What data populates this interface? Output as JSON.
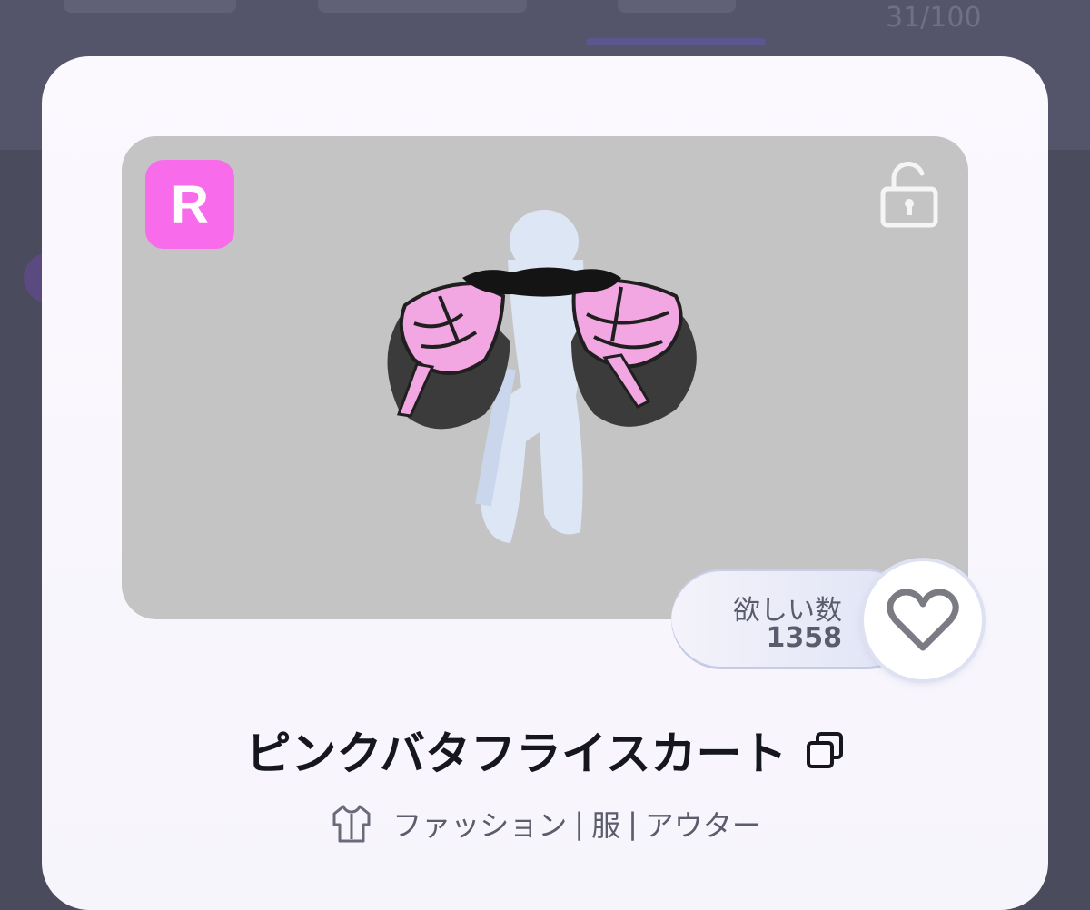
{
  "background": {
    "collection_count": "31/100"
  },
  "item": {
    "rarity": "R",
    "wish_label": "欲しい数",
    "wish_count": "1358",
    "name": "ピンクバタフライスカート",
    "categories": [
      "ファッション",
      "服",
      "アウター"
    ]
  },
  "colors": {
    "rarity_badge": "#f86bea",
    "preview_bg": "#c4c4c4",
    "wing_pink": "#f3a3e4",
    "wing_dark": "#2a2a2a"
  },
  "icons": {
    "lock": "unlock-icon",
    "heart": "heart-outline-icon",
    "copy": "copy-icon",
    "category": "shirt-icon"
  }
}
